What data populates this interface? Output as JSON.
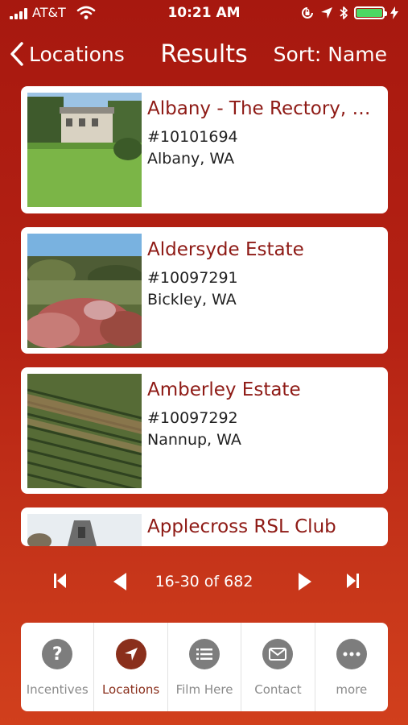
{
  "status_bar": {
    "carrier": "AT&T",
    "time": "10:21 AM"
  },
  "nav": {
    "back_label": "Locations",
    "title": "Results",
    "sort_label": "Sort: Name"
  },
  "results": [
    {
      "name": "Albany - The Rectory, S...",
      "id": "#10101694",
      "location": "Albany, WA"
    },
    {
      "name": "Aldersyde Estate",
      "id": "#10097291",
      "location": "Bickley, WA"
    },
    {
      "name": "Amberley Estate",
      "id": "#10097292",
      "location": "Nannup, WA"
    },
    {
      "name": "Applecross RSL Club"
    }
  ],
  "pagination": {
    "range_text": "16-30 of 682"
  },
  "tabs": [
    {
      "label": "Incentives",
      "icon": "question-icon"
    },
    {
      "label": "Locations",
      "icon": "location-arrow-icon",
      "active": true
    },
    {
      "label": "Film Here",
      "icon": "list-icon"
    },
    {
      "label": "Contact",
      "icon": "mail-icon"
    },
    {
      "label": "more",
      "icon": "more-icon"
    }
  ],
  "colors": {
    "accent": "#8e1a15",
    "active_tab": "#8a2f1c",
    "battery": "#4cd964"
  }
}
